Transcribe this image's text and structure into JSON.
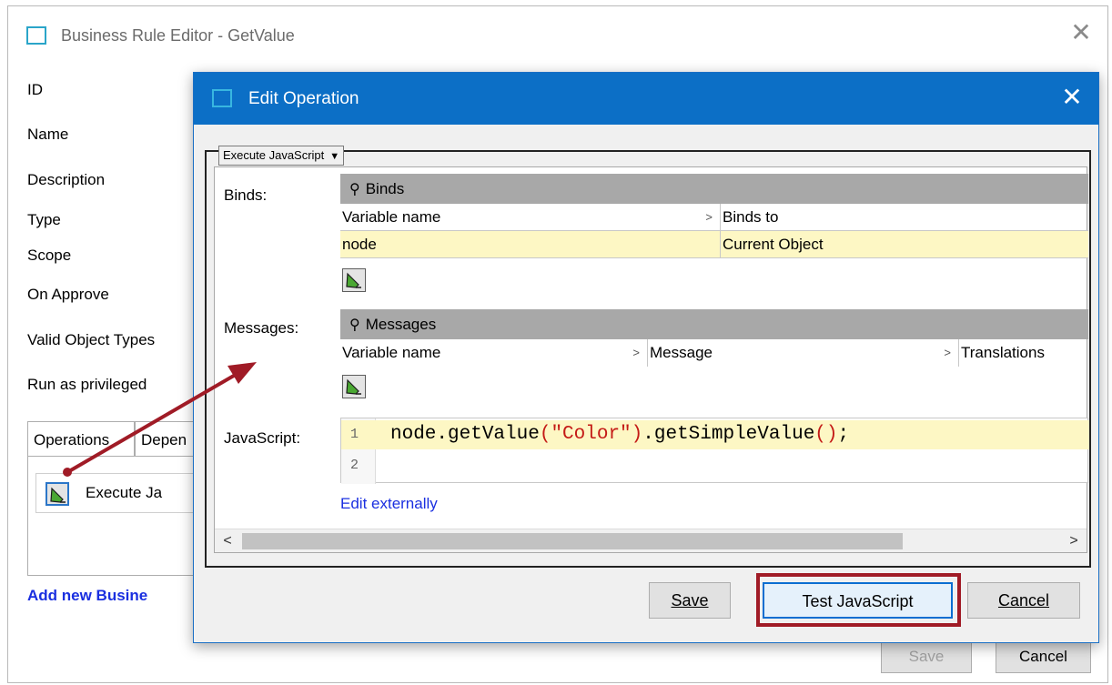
{
  "background_dialog": {
    "title": "Business Rule Editor - GetValue",
    "field_labels": [
      "ID",
      "Name",
      "Description",
      "Type",
      "Scope",
      "On Approve",
      "Valid Object Types",
      "Run as privileged"
    ],
    "tabs": [
      "Operations",
      "Depen"
    ],
    "operation_item": "Execute Ja",
    "add_link": "Add new Busine",
    "save_label": "Save",
    "cancel_label": "Cancel"
  },
  "edit_operation": {
    "title": "Edit Operation",
    "operation_type": "Execute JavaScript",
    "binds": {
      "label": "Binds:",
      "header": "Binds",
      "columns": [
        "Variable name",
        "Binds to"
      ],
      "rows": [
        [
          "node",
          "Current Object"
        ]
      ]
    },
    "messages": {
      "label": "Messages:",
      "header": "Messages",
      "columns": [
        "Variable name",
        "Message",
        "Translations"
      ]
    },
    "javascript": {
      "label": "JavaScript:",
      "line_numbers": [
        "1",
        "2"
      ],
      "code_parts": [
        "node.getValue",
        "(",
        "\"Color\"",
        ")",
        ".getSimpleValue",
        "()",
        ";"
      ],
      "edit_externally": "Edit externally"
    },
    "buttons": {
      "save": "Save",
      "test": "Test JavaScript",
      "cancel": "Cancel"
    }
  },
  "colors": {
    "titlebar": "#0c6fc6",
    "highlight_row": "#fdf7c4",
    "annotation": "#a01b26",
    "link": "#1a2fe0"
  }
}
